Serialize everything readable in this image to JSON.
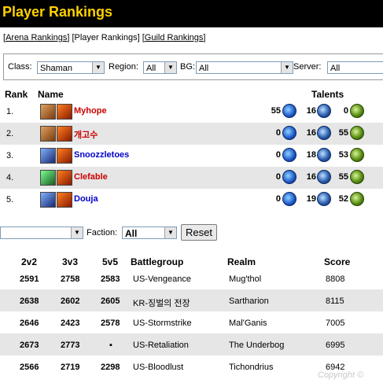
{
  "header": {
    "title": "Player Rankings"
  },
  "links": {
    "arena": "Arena Rankings",
    "player": "Player Rankings",
    "guild": "Guild Rankings"
  },
  "filters": {
    "class_label": "Class:",
    "class_value": "Shaman",
    "region_label": "Region:",
    "region_value": "All",
    "bg_label": "BG:",
    "bg_value": "All",
    "server_label": "Server:",
    "server_value": "All"
  },
  "columns": {
    "rank": "Rank",
    "name": "Name",
    "talents": "Talents"
  },
  "players": [
    {
      "rank": "1.",
      "name": "Myhope",
      "t1": "55",
      "t2": "16",
      "t3": "0",
      "color": "#cc0000"
    },
    {
      "rank": "2.",
      "name": "개고수",
      "t1": "0",
      "t2": "16",
      "t3": "55",
      "color": "#cc0000"
    },
    {
      "rank": "3.",
      "name": "Snoozzletoes",
      "t1": "0",
      "t2": "18",
      "t3": "53",
      "color": "#0000cc"
    },
    {
      "rank": "4.",
      "name": "Clefable",
      "t1": "0",
      "t2": "16",
      "t3": "55",
      "color": "#cc0000"
    },
    {
      "rank": "5.",
      "name": "Douja",
      "t1": "0",
      "t2": "19",
      "t3": "52",
      "color": "#0000cc"
    }
  ],
  "bottom_filter": {
    "faction_label": "Faction:",
    "faction_value": "All",
    "reset_label": "Reset"
  },
  "table_columns": {
    "c2v2": "2v2",
    "c3v3": "3v3",
    "c5v5": "5v5",
    "battlegroup": "Battlegroup",
    "realm": "Realm",
    "score": "Score"
  },
  "table_rows": [
    {
      "v2": "2591",
      "v3": "2758",
      "v5": "2583",
      "bg": "US-Vengeance",
      "realm": "Mug'thol",
      "score": "8808"
    },
    {
      "v2": "2638",
      "v3": "2602",
      "v5": "2605",
      "bg": "KR-징벌의 전장",
      "realm": "Sartharion",
      "score": "8115"
    },
    {
      "v2": "2646",
      "v3": "2423",
      "v5": "2578",
      "bg": "US-Stormstrike",
      "realm": "Mal'Ganis",
      "score": "7005"
    },
    {
      "v2": "2673",
      "v3": "2773",
      "v5": "▪",
      "bg": "US-Retaliation",
      "realm": "The Underbog",
      "score": "6995"
    },
    {
      "v2": "2566",
      "v3": "2719",
      "v5": "2298",
      "bg": "US-Bloodlust",
      "realm": "Tichondrius",
      "score": "6942"
    }
  ],
  "footer": {
    "copyright": "Copyright ©"
  }
}
